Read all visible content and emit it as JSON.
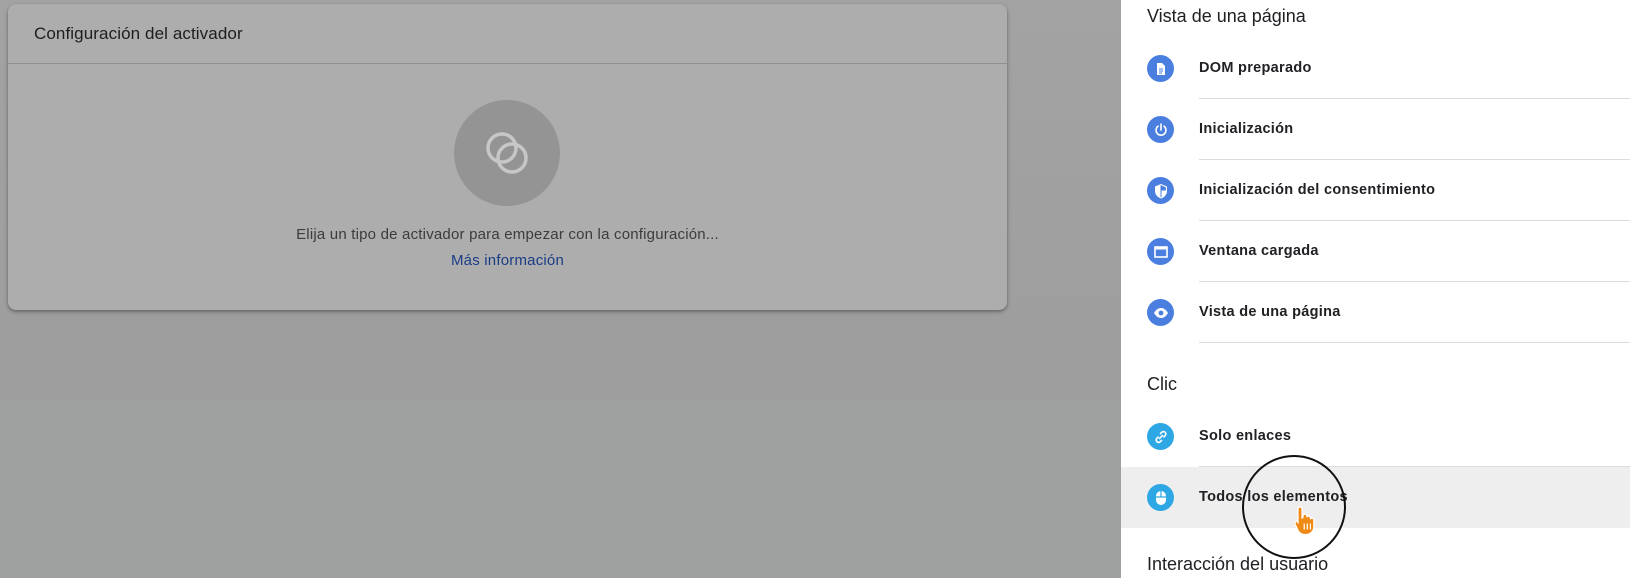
{
  "config_card": {
    "title": "Configuración del activador",
    "hint": "Elija un tipo de activador para empezar con la configuración...",
    "more_link": "Más información",
    "placeholder_icon": "trigger-circles-icon"
  },
  "panel": {
    "sections": [
      {
        "title": "Vista de una página",
        "items": [
          {
            "label": "DOM preparado",
            "icon": "document-icon"
          },
          {
            "label": "Inicialización",
            "icon": "power-icon"
          },
          {
            "label": "Inicialización del consentimiento",
            "icon": "shield-icon"
          },
          {
            "label": "Ventana cargada",
            "icon": "window-icon"
          },
          {
            "label": "Vista de una página",
            "icon": "eye-icon"
          }
        ]
      },
      {
        "title": "Clic",
        "items": [
          {
            "label": "Solo enlaces",
            "icon": "link-icon"
          },
          {
            "label": "Todos los elementos",
            "icon": "mouse-icon"
          }
        ]
      },
      {
        "title": "Interacción del usuario",
        "items": []
      }
    ]
  },
  "colors": {
    "page_view_icon": "#4a7fe0",
    "click_icon": "#2ea8e4",
    "link": "#1b3d86",
    "cursor": "#f08a16"
  }
}
